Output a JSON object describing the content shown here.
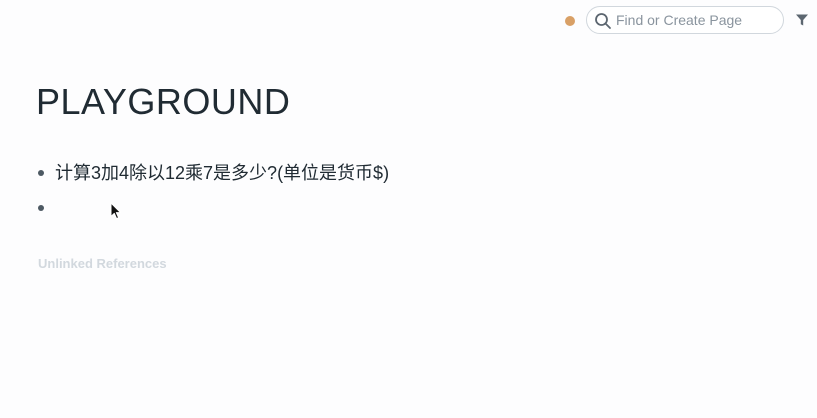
{
  "topbar": {
    "status_dot_color": "#d9a066",
    "search_placeholder": "Find or Create Page",
    "search_icon": "search-icon",
    "filter_icon": "filter-icon"
  },
  "page": {
    "title": "PLAYGROUND",
    "blocks": [
      {
        "text": "计算3加4除以12乘7是多少?(单位是货币$)"
      },
      {
        "text": ""
      }
    ],
    "unlinked_references_label": "Unlinked References"
  }
}
